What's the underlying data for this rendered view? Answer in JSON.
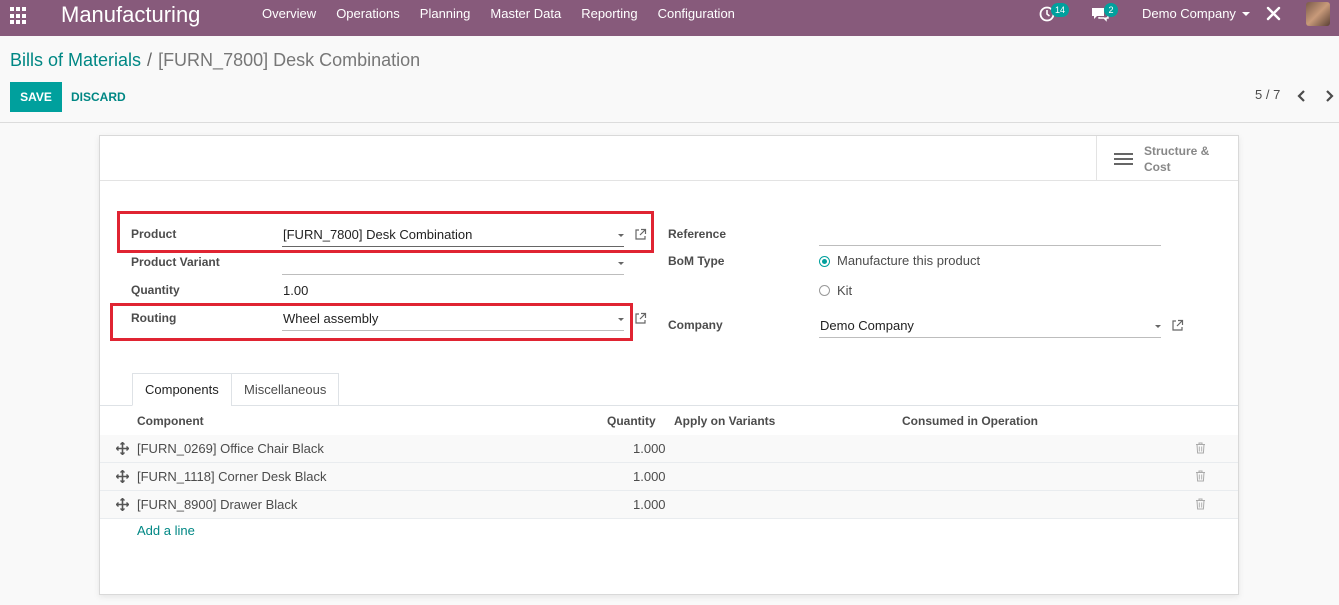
{
  "navbar": {
    "app_name": "Manufacturing",
    "menu": [
      "Overview",
      "Operations",
      "Planning",
      "Master Data",
      "Reporting",
      "Configuration"
    ],
    "activity_count": "14",
    "message_count": "2",
    "company": "Demo Company",
    "accent": "#875a7b"
  },
  "breadcrumb": {
    "parent": "Bills of Materials",
    "separator": "/",
    "current": "[FURN_7800] Desk Combination"
  },
  "actions": {
    "save": "SAVE",
    "discard": "DISCARD"
  },
  "pager": {
    "value": "5 / 7"
  },
  "stat_button": {
    "line1": "Structure &",
    "line2": "Cost"
  },
  "form": {
    "product_label": "Product",
    "product_value": "[FURN_7800] Desk Combination",
    "variant_label": "Product Variant",
    "variant_value": "",
    "quantity_label": "Quantity",
    "quantity_value": "1.00",
    "routing_label": "Routing",
    "routing_value": "Wheel assembly",
    "reference_label": "Reference",
    "reference_value": "",
    "bom_type_label": "BoM Type",
    "bom_type_options": [
      "Manufacture this product",
      "Kit"
    ],
    "bom_type_selected": "Manufacture this product",
    "company_label": "Company",
    "company_value": "Demo Company"
  },
  "tabs": [
    "Components",
    "Miscellaneous"
  ],
  "components": {
    "columns": [
      "Component",
      "Quantity",
      "Apply on Variants",
      "Consumed in Operation"
    ],
    "rows": [
      {
        "component": "[FURN_0269] Office Chair Black",
        "quantity": "1.000"
      },
      {
        "component": "[FURN_1118] Corner Desk Black",
        "quantity": "1.000"
      },
      {
        "component": "[FURN_8900] Drawer Black",
        "quantity": "1.000"
      }
    ],
    "add_line": "Add a line"
  },
  "colors": {
    "primary": "#00a09d",
    "link": "#008784",
    "highlight": "#e02432"
  }
}
